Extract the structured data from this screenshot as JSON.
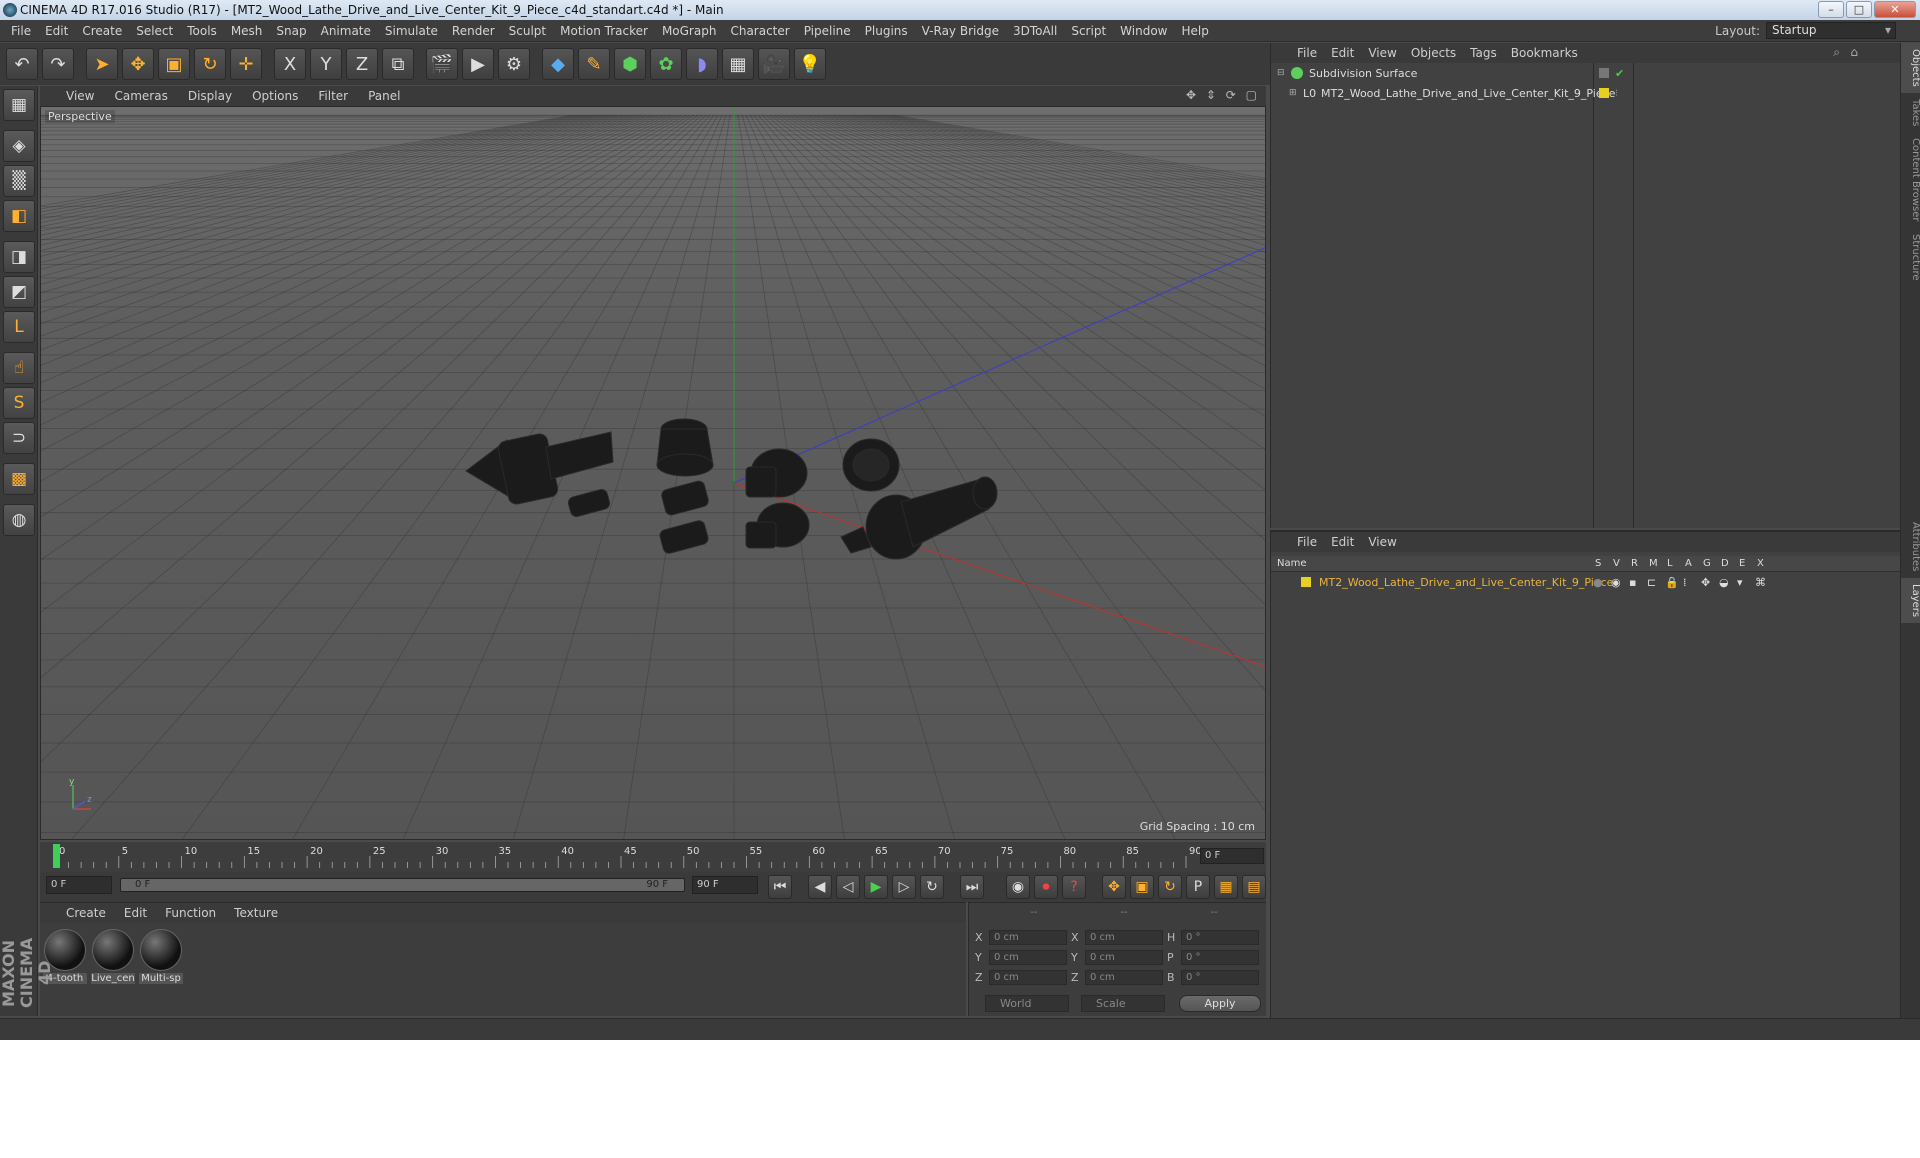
{
  "window": {
    "title": "CINEMA 4D R17.016 Studio (R17) - [MT2_Wood_Lathe_Drive_and_Live_Center_Kit_9_Piece_c4d_standart.c4d *] - Main",
    "minimize": "–",
    "maximize": "□",
    "close": "✕"
  },
  "menu": [
    "File",
    "Edit",
    "Create",
    "Select",
    "Tools",
    "Mesh",
    "Snap",
    "Animate",
    "Simulate",
    "Render",
    "Sculpt",
    "Motion Tracker",
    "MoGraph",
    "Character",
    "Pipeline",
    "Plugins",
    "V-Ray Bridge",
    "3DToAll",
    "Script",
    "Window",
    "Help"
  ],
  "layout": {
    "label": "Layout:",
    "value": "Startup"
  },
  "toolbar": {
    "undo": "↶",
    "redo": "↷",
    "select": "➤",
    "move": "✥",
    "scale": "▣",
    "rotate": "↻",
    "transform": "✛",
    "x_axis": "X",
    "y_axis": "Y",
    "z_axis": "Z",
    "coord": "⧉",
    "render_view": "🎬",
    "render_pic": "▶",
    "render_settings": "⚙",
    "cube": "◆",
    "pen": "✎",
    "subdiv": "⬢",
    "mograph": "✿",
    "deformer": "◗",
    "floor": "▦",
    "camera": "🎥",
    "light": "💡"
  },
  "left_toolbar": [
    "▦",
    "◈",
    "▒",
    "◧",
    "◨",
    "◩",
    "L",
    "☝",
    "S",
    "⊃",
    "▩",
    "◍"
  ],
  "viewport": {
    "menu": [
      "View",
      "Cameras",
      "Display",
      "Options",
      "Filter",
      "Panel"
    ],
    "nav": "✥ ⇕ ⟳ ▢",
    "label": "Perspective",
    "grid_spacing": "Grid Spacing : 10 cm",
    "axis_y": "y",
    "axis_z": "z"
  },
  "timeline": {
    "ticks": [
      "0",
      "5",
      "10",
      "15",
      "20",
      "25",
      "30",
      "35",
      "40",
      "45",
      "50",
      "55",
      "60",
      "65",
      "70",
      "75",
      "80",
      "85",
      "90"
    ],
    "current_frame": "0 F",
    "start_frame": "0 F",
    "range_start": "0 F",
    "range_end": "90 F",
    "end_frame": "90 F"
  },
  "transport": {
    "first": "⏮",
    "prev_key": "◀",
    "prev": "◁",
    "play": "▶",
    "next": "▷",
    "next_key": "↻",
    "last": "⏭",
    "autokey": "◉",
    "record": "⏺",
    "help": "?",
    "move_key": "✥",
    "scale_key": "▣",
    "rot_key": "↻",
    "param": "P",
    "grid": "▦",
    "anim_layout": "▤"
  },
  "materials": {
    "menu": [
      "Create",
      "Edit",
      "Function",
      "Texture"
    ],
    "items": [
      "4-tooth",
      "Live_cen",
      "Multi-sp"
    ]
  },
  "logo": "MAXON CINEMA 4D",
  "coords": {
    "header": [
      "--",
      "--",
      "--"
    ],
    "rows": [
      {
        "a": "X",
        "v1": "0 cm",
        "b": "X",
        "v2": "0 cm",
        "c": "H",
        "v3": "0 °"
      },
      {
        "a": "Y",
        "v1": "0 cm",
        "b": "Y",
        "v2": "0 cm",
        "c": "P",
        "v3": "0 °"
      },
      {
        "a": "Z",
        "v1": "0 cm",
        "b": "Z",
        "v2": "0 cm",
        "c": "B",
        "v3": "0 °"
      }
    ],
    "world": "World",
    "scale": "Scale",
    "apply": "Apply"
  },
  "object_manager": {
    "menu": [
      "File",
      "Edit",
      "View",
      "Objects",
      "Tags",
      "Bookmarks"
    ],
    "objects": [
      {
        "name": "Subdivision Surface"
      },
      {
        "name": "MT2_Wood_Lathe_Drive_and_Live_Center_Kit_9_Piece"
      }
    ]
  },
  "layer_manager": {
    "menu": [
      "File",
      "Edit",
      "View"
    ],
    "columns": [
      "Name",
      "S",
      "V",
      "R",
      "M",
      "L",
      "A",
      "G",
      "D",
      "E",
      "X"
    ],
    "layer": "MT2_Wood_Lathe_Drive_and_Live_Center_Kit_9_Piece"
  },
  "side_tabs": [
    "Objects",
    "Takes",
    "Content Browser",
    "Structure",
    "Attributes",
    "Layers"
  ],
  "colors": {
    "accent": "#ffcc33",
    "layer_text": "#e8b341",
    "green_check": "#44cc44"
  }
}
